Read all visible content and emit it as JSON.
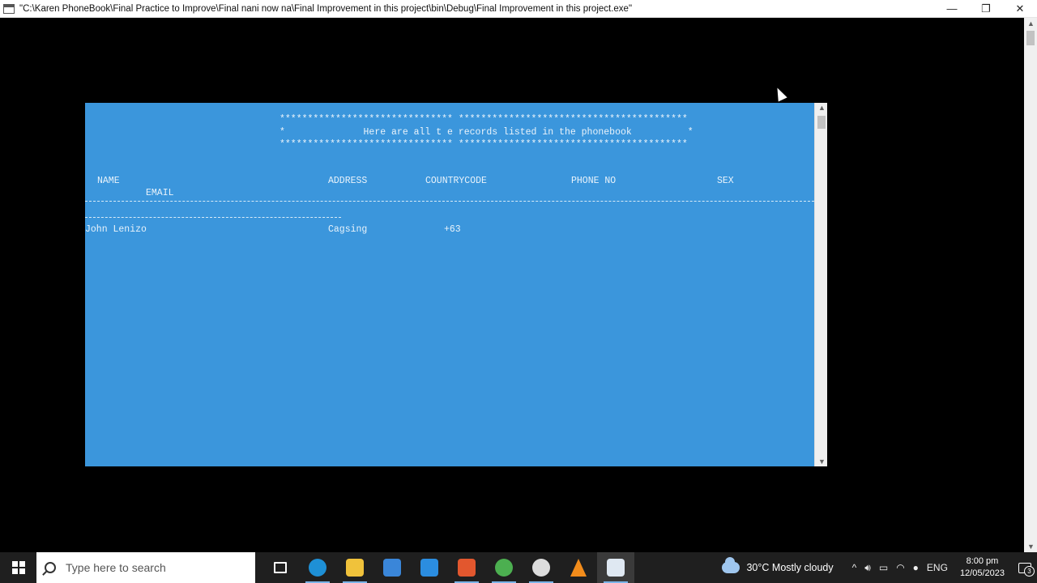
{
  "window": {
    "title": "\"C:\\Karen PhoneBook\\Final Practice to Improve\\Final nani now na\\Final Improvement in this project\\bin\\Debug\\Final Improvement in this project.exe\"",
    "minimize": "—",
    "restore": "❐",
    "close": "✕"
  },
  "console": {
    "stars_top": "******************************* *****************************************",
    "heading": "*              Here are all t e records listed in the phonebook          *",
    "stars_bottom": "******************************* *****************************************",
    "columns": {
      "name": "NAME",
      "email": "EMAIL",
      "address": "ADDRESS",
      "countrycode": "COUNTRYCODE",
      "phone": "PHONE NO",
      "sex": "SEX"
    },
    "rows": [
      {
        "name": "John Lenizo",
        "address": "Cagsing",
        "countrycode": "+63"
      }
    ]
  },
  "taskbar": {
    "search_placeholder": "Type here to search",
    "apps": [
      {
        "name": "task-view",
        "color": "#ffffff"
      },
      {
        "name": "edge",
        "color": "#1e90d6"
      },
      {
        "name": "file-explorer",
        "color": "#f0c23b"
      },
      {
        "name": "microsoft-store",
        "color": "#3a86d9"
      },
      {
        "name": "mail",
        "color": "#2b8de0"
      },
      {
        "name": "office",
        "color": "#e2572e"
      },
      {
        "name": "chrome",
        "color": "#4caf50"
      },
      {
        "name": "obs",
        "color": "#dddddd"
      },
      {
        "name": "vlc",
        "color": "#f28c1b"
      },
      {
        "name": "console-app",
        "color": "#dfe8f2"
      }
    ],
    "weather_temp": "30°C",
    "weather_desc": "Mostly cloudy",
    "language": "ENG",
    "time": "8:00 pm",
    "date": "12/05/2023",
    "notification_count": "3"
  }
}
